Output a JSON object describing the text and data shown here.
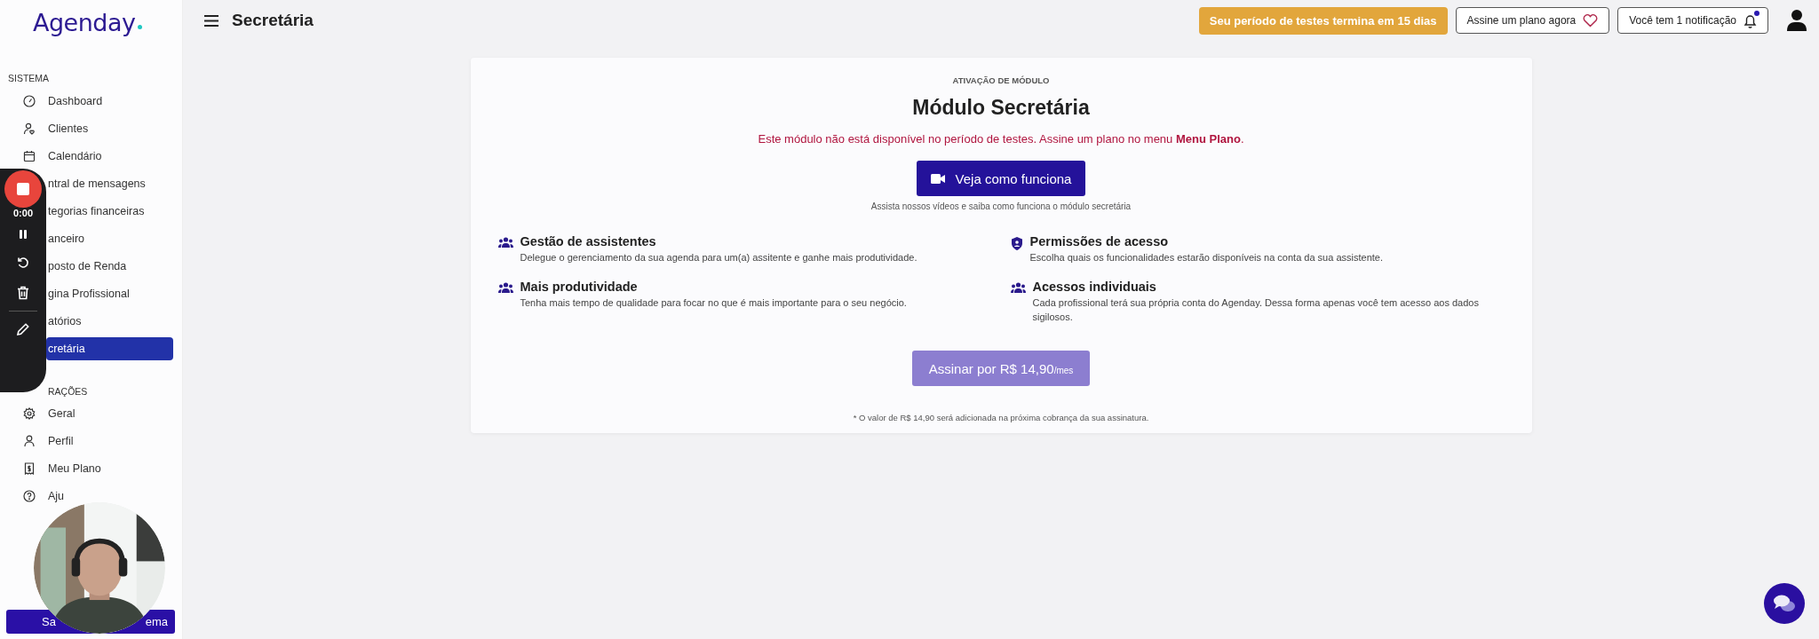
{
  "sidebar": {
    "logo": "Agenday",
    "sections": [
      {
        "title": "SISTEMA",
        "items": [
          {
            "label": "Dashboard",
            "selected": false,
            "covered": false
          },
          {
            "label": "Clientes",
            "selected": false,
            "covered": false
          },
          {
            "label": "Calendário",
            "selected": false,
            "covered": false
          },
          {
            "label": "ntral de mensagens",
            "selected": false,
            "covered": true
          },
          {
            "label": "tegorias financeiras",
            "selected": false,
            "covered": true
          },
          {
            "label": "anceiro",
            "selected": false,
            "covered": true
          },
          {
            "label": "posto de Renda",
            "selected": false,
            "covered": true
          },
          {
            "label": "gina Profissional",
            "selected": false,
            "covered": true
          },
          {
            "label": "atórios",
            "selected": false,
            "covered": true
          },
          {
            "label": "cretária",
            "selected": true,
            "covered": true
          }
        ]
      },
      {
        "title": "RAÇÕES",
        "items": [
          {
            "label": "Geral",
            "selected": false,
            "covered": false
          },
          {
            "label": "Perfil",
            "selected": false,
            "covered": false
          },
          {
            "label": "Meu Plano",
            "selected": false,
            "covered": false
          },
          {
            "label": "Aju",
            "selected": false,
            "covered": false
          }
        ]
      }
    ],
    "bottom_button": {
      "start": "Sa",
      "end": "ema"
    }
  },
  "recorder": {
    "time": "0:00"
  },
  "header": {
    "title": "Secretária",
    "trial": "Seu período de testes termina em 15 dias",
    "subscribe": "Assine um plano agora",
    "notifications": "Você tem 1 notificação",
    "unread": true
  },
  "card": {
    "eyebrow": "ATIVAÇÃO DE MÓDULO",
    "title": "Módulo Secretária",
    "warning": "Este módulo não está disponível no período de testes. Assine um plano no menu **Menu Plano**.",
    "video_button": "Veja como funciona",
    "video_caption": "Assista nossos vídeos e saiba como funciona o módulo secretária",
    "features": [
      {
        "title": "Gestão de assistentes",
        "text": "Delegue o gerenciamento da sua agenda para um(a) assitente e ganhe mais produtividade."
      },
      {
        "title": "Permissões de acesso",
        "text": "Escolha quais os funcionalidades estarão disponíveis na conta da sua assistente."
      },
      {
        "title": "Mais produtividade",
        "text": "Tenha mais tempo de qualidade para focar no que é mais importante para o seu negócio."
      },
      {
        "title": "Acessos individuais",
        "text": "Cada profissional terá sua própria conta do Agenday. Dessa forma apenas você tem acesso aos dados sigilosos."
      }
    ],
    "buy_button": {
      "label": "Assinar por R$ 14,90",
      "suffix": "/mes"
    },
    "footnote": "* O valor de R$ 14,90 será adicionada na próxima cobrança da sua assinatura."
  }
}
